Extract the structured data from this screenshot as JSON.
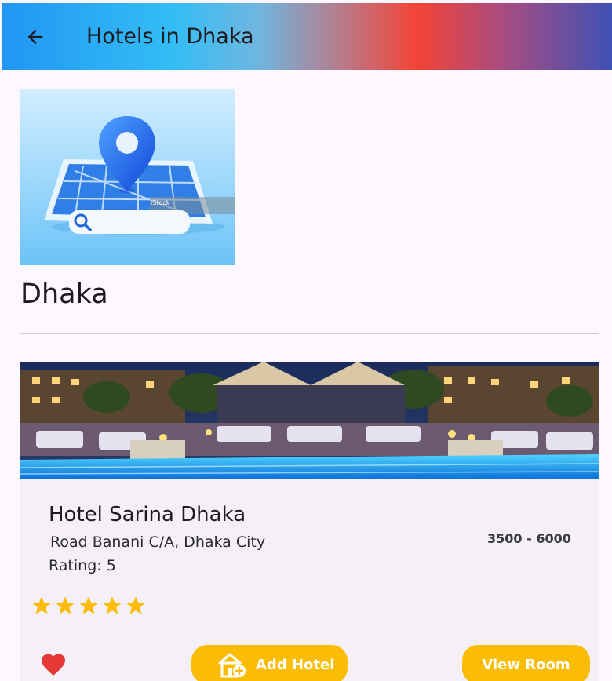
{
  "appbar": {
    "title": "Hotels in Dhaka",
    "back_icon": "arrow-back-icon"
  },
  "city": {
    "name": "Dhaka",
    "image_icon": "map-location-pin-image",
    "image_watermark": "iStock"
  },
  "hotel": {
    "name": "Hotel Sarina Dhaka",
    "address": " Road Banani C/A, Dhaka City",
    "rating_text": "Rating: 5",
    "rating_value": 5,
    "price_range": "3500 - 6000",
    "favorite_icon": "heart-icon",
    "image_icon": "hotel-pool-image"
  },
  "actions": {
    "add_hotel_label": "Add Hotel",
    "add_hotel_icon": "add-home-icon",
    "view_room_label": "View Room"
  },
  "colors": {
    "accent_yellow": "#fbbc05",
    "star_color": "#fbbc05",
    "heart_color": "#e53935",
    "background": "#fdf7ff",
    "card": "#f5eff7"
  }
}
